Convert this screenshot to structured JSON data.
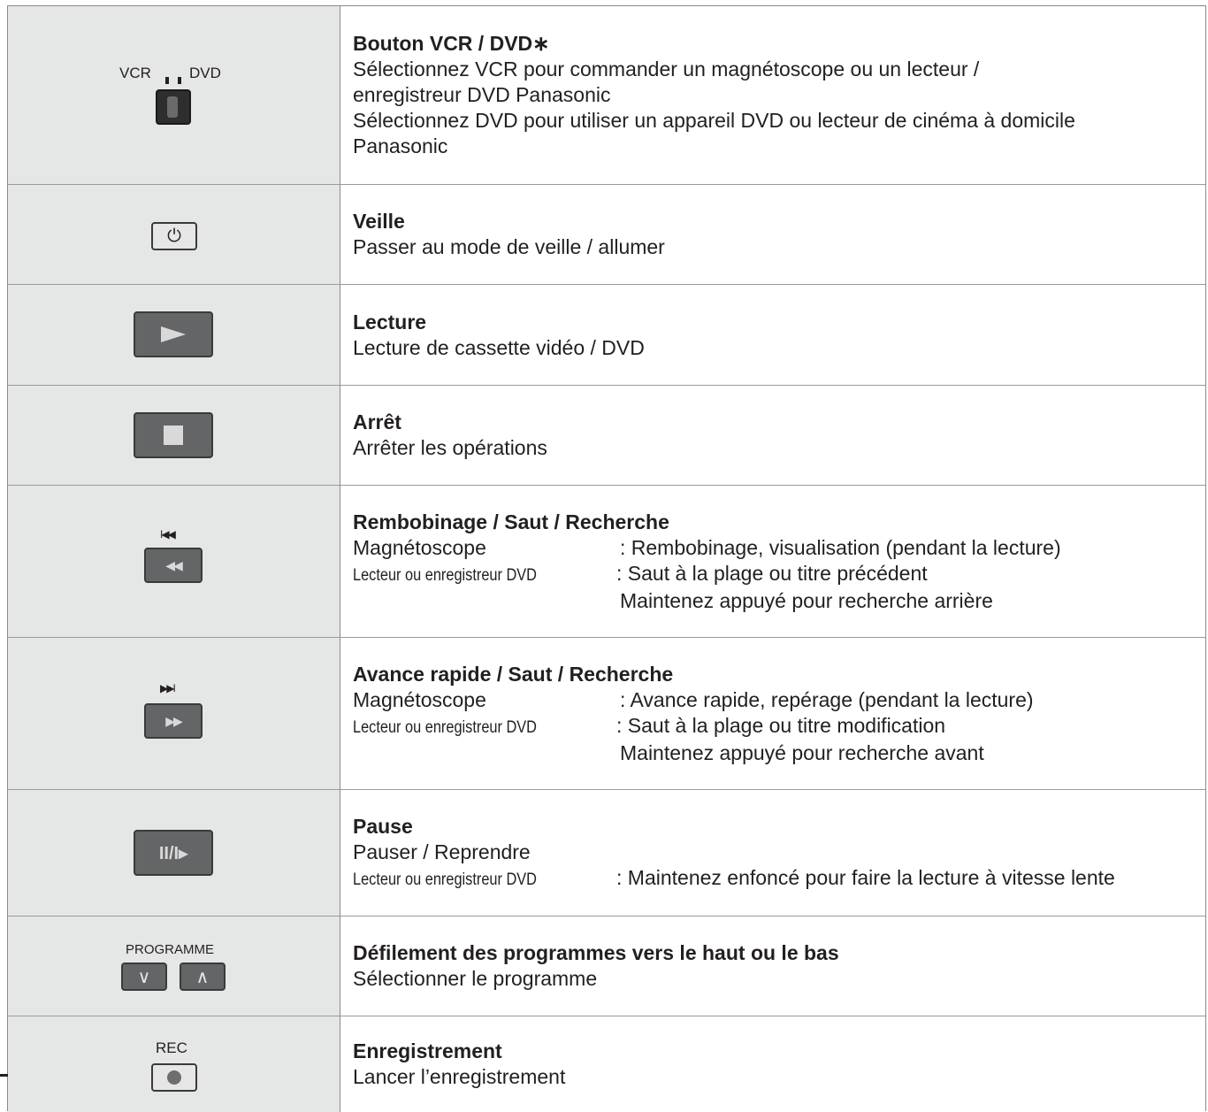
{
  "rows": [
    {
      "icon": "vcr-dvd-switch-icon",
      "icon_label_left": "VCR",
      "icon_label_right": "DVD",
      "title": "Bouton VCR / DVD∗",
      "lines": [
        "Sélectionnez VCR pour commander un magnétoscope ou un lecteur /",
        "enregistreur DVD Panasonic",
        "Sélectionnez DVD pour utiliser un appareil DVD ou lecteur de cinéma à domicile",
        "Panasonic"
      ]
    },
    {
      "icon": "power-icon",
      "icon_glyph": "⏻",
      "title": "Veille",
      "lines": [
        "Passer au mode de veille / allumer"
      ]
    },
    {
      "icon": "play-icon",
      "title": "Lecture",
      "lines": [
        "Lecture de cassette vidéo / DVD"
      ]
    },
    {
      "icon": "stop-icon",
      "title": "Arrêt",
      "lines": [
        "Arrêter les opérations"
      ]
    },
    {
      "icon": "rewind-skip-icon",
      "icon_top_glyph": "I◀◀",
      "icon_glyph": "◀◀",
      "title": "Rembobinage / Saut / Recherche",
      "pairs": [
        {
          "label": "Magnétoscope",
          "value": ": Rembobinage, visualisation (pendant la lecture)"
        },
        {
          "label": "Lecteur ou enregistreur DVD",
          "value": ": Saut à la plage ou titre précédent"
        }
      ],
      "indent_line": "Maintenez appuyé pour recherche arrière"
    },
    {
      "icon": "fast-forward-skip-icon",
      "icon_top_glyph": "▶▶I",
      "icon_glyph": "▶▶",
      "title": "Avance rapide / Saut / Recherche",
      "pairs": [
        {
          "label": "Magnétoscope",
          "value": ": Avance rapide, repérage (pendant la lecture)"
        },
        {
          "label": "Lecteur ou enregistreur DVD",
          "value": ": Saut à la plage ou titre modification"
        }
      ],
      "indent_line": "Maintenez appuyé pour recherche avant"
    },
    {
      "icon": "pause-slow-icon",
      "icon_glyph": "II/I▸",
      "title": "Pause",
      "lines": [
        "Pauser / Reprendre"
      ],
      "pairs": [
        {
          "label": "Lecteur ou enregistreur DVD",
          "value": ": Maintenez enfoncé pour faire la lecture à vitesse lente"
        }
      ]
    },
    {
      "icon": "programme-up-down-icon",
      "icon_label": "PROGRAMME",
      "icon_glyph_down": "∨",
      "icon_glyph_up": "∧",
      "title": "Défilement des programmes vers le haut ou le bas",
      "lines": [
        "Sélectionner le programme"
      ]
    },
    {
      "icon": "record-icon",
      "icon_label": "REC",
      "title": "Enregistrement",
      "lines": [
        "Lancer l’enregistrement"
      ]
    }
  ]
}
